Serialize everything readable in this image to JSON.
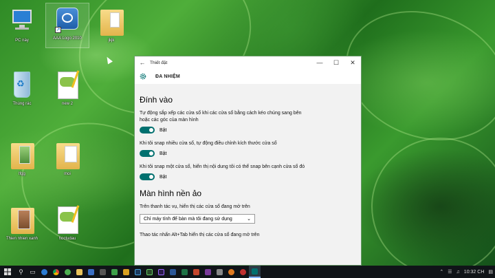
{
  "desktop": {
    "icons": [
      {
        "label": "PC này",
        "icon": "computer-icon"
      },
      {
        "label": "AAA Logo 2010",
        "icon": "app-shortcut-icon"
      },
      {
        "label": "jkjk",
        "icon": "folder-icon"
      },
      {
        "label": "Thùng rác",
        "icon": "recycle-bin-icon"
      },
      {
        "label": "new 2",
        "icon": "document-icon"
      },
      {
        "label": "lfgg",
        "icon": "folder-icon"
      },
      {
        "label": "moi",
        "icon": "folder-icon"
      },
      {
        "label": "Thien nhien xanh",
        "icon": "folder-icon"
      },
      {
        "label": "hoctudau",
        "icon": "document-icon"
      }
    ]
  },
  "window": {
    "title": "Thiết đặt",
    "header_title": "ĐA NHIỆM",
    "section1_title": "Đính vào",
    "snap1_desc": "Tự động sắp xếp các cửa sổ khi các cửa sổ bằng cách kéo chúng sang bên hoặc các góc của màn hình",
    "snap1_state": "Bật",
    "snap2_desc": "Khi tôi snap nhiều cửa sổ, tự động điều chỉnh kích thước cửa sổ",
    "snap2_state": "Bật",
    "snap3_desc": "Khi tôi snap một cửa sổ, hiển thị nội dung tôi có thể snap bên cạnh cửa sổ đó",
    "snap3_state": "Bật",
    "section2_title": "Màn hình nền ảo",
    "taskbar_label": "Trên thanh tác vụ, hiển thị các cửa sổ đang mở trên",
    "taskbar_value": "Chỉ máy tính để bàn mà tôi đang sử dụng",
    "alttab_label": "Thao tác nhấn Alt+Tab hiển thị các cửa sổ đang mở trên"
  },
  "taskbar": {
    "clock": "10:32 CH",
    "accent": "#00706f"
  }
}
